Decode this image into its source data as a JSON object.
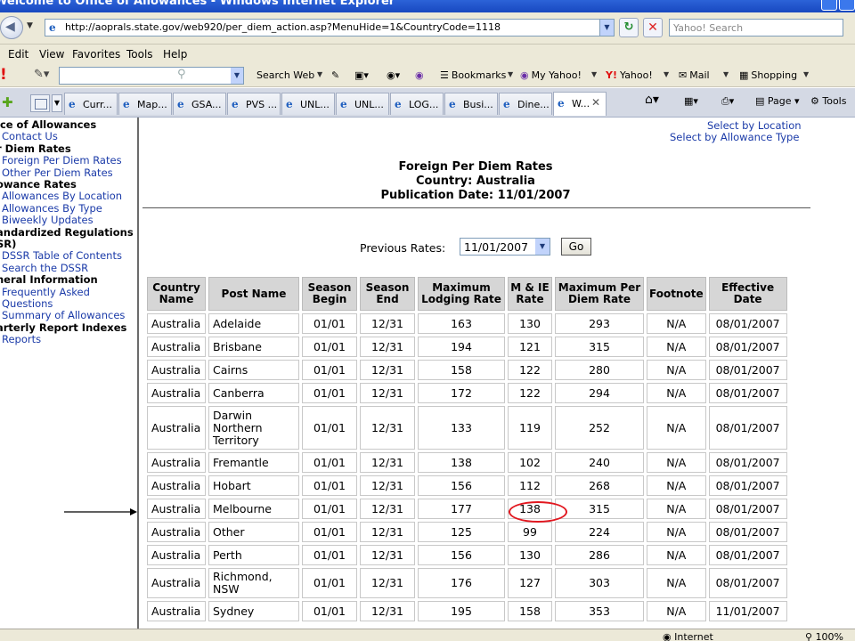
{
  "window": {
    "title": "Welcome to Office of Allowances - Windows Internet Explorer"
  },
  "address_bar": {
    "url": "http://aoprals.state.gov/web920/per_diem_action.asp?MenuHide=1&CountryCode=1118"
  },
  "search": {
    "placeholder": "Yahoo! Search"
  },
  "menu": [
    "Edit",
    "View",
    "Favorites",
    "Tools",
    "Help"
  ],
  "yahoo_toolbar": {
    "search_web": "Search Web",
    "bookmarks": "Bookmarks",
    "my_yahoo": "My Yahoo!",
    "yahoo": "Yahoo!",
    "mail": "Mail",
    "shopping": "Shopping"
  },
  "tabs": [
    "Curr...",
    "Map...",
    "GSA...",
    "PVS ...",
    "UNL...",
    "UNL...",
    "LOG...",
    "Busi...",
    "Dine...",
    "W..."
  ],
  "tab_toolbar": {
    "page": "Page",
    "tools": "Tools"
  },
  "sidebar": [
    {
      "text": "ice of Allowances",
      "type": "head"
    },
    {
      "text": "Contact Us",
      "type": "link"
    },
    {
      "text": "r Diem Rates",
      "type": "head"
    },
    {
      "text": "Foreign Per Diem Rates",
      "type": "link"
    },
    {
      "text": "Other Per Diem Rates",
      "type": "link"
    },
    {
      "text": "owance Rates",
      "type": "head"
    },
    {
      "text": "Allowances By Location",
      "type": "link"
    },
    {
      "text": "Allowances By Type",
      "type": "link"
    },
    {
      "text": "Biweekly Updates",
      "type": "link"
    },
    {
      "text": "andardized Regulations",
      "type": "head"
    },
    {
      "text": "SR)",
      "type": "head"
    },
    {
      "text": "DSSR Table of Contents",
      "type": "link"
    },
    {
      "text": "Search the DSSR",
      "type": "link"
    },
    {
      "text": "neral Information",
      "type": "head"
    },
    {
      "text": "Frequently Asked",
      "type": "link"
    },
    {
      "text": "Questions",
      "type": "link"
    },
    {
      "text": "Summary of Allowances",
      "type": "link"
    },
    {
      "text": "arterly Report Indexes",
      "type": "head"
    },
    {
      "text": "Reports",
      "type": "link"
    }
  ],
  "links": {
    "select_by_location": "Select by Location",
    "select_by_type": "Select by Allowance Type"
  },
  "heading": {
    "line1": "Foreign Per Diem Rates",
    "line2": "Country: Australia",
    "line3": "Publication Date: 11/01/2007"
  },
  "previous_rates": {
    "label": "Previous Rates:",
    "selected": "11/01/2007",
    "go": "Go"
  },
  "table": {
    "headers": [
      [
        "Country",
        "Name"
      ],
      [
        "Post Name"
      ],
      [
        "Season",
        "Begin"
      ],
      [
        "Season",
        "End"
      ],
      [
        "Maximum",
        "Lodging Rate"
      ],
      [
        "M & IE",
        "Rate"
      ],
      [
        "Maximum Per",
        "Diem Rate"
      ],
      [
        "Footnote"
      ],
      [
        "Effective",
        "Date"
      ]
    ],
    "rows": [
      {
        "post": [
          "Adelaide"
        ],
        "country": "Australia",
        "begin": "01/01",
        "end": "12/31",
        "lodging": "163",
        "mie": "130",
        "max": "293",
        "footnote": "N/A",
        "effective": "08/01/2007"
      },
      {
        "post": [
          "Brisbane"
        ],
        "country": "Australia",
        "begin": "01/01",
        "end": "12/31",
        "lodging": "194",
        "mie": "121",
        "max": "315",
        "footnote": "N/A",
        "effective": "08/01/2007"
      },
      {
        "post": [
          "Cairns"
        ],
        "country": "Australia",
        "begin": "01/01",
        "end": "12/31",
        "lodging": "158",
        "mie": "122",
        "max": "280",
        "footnote": "N/A",
        "effective": "08/01/2007"
      },
      {
        "post": [
          "Canberra"
        ],
        "country": "Australia",
        "begin": "01/01",
        "end": "12/31",
        "lodging": "172",
        "mie": "122",
        "max": "294",
        "footnote": "N/A",
        "effective": "08/01/2007"
      },
      {
        "post": [
          "Darwin",
          "Northern",
          "Territory"
        ],
        "country": "Australia",
        "begin": "01/01",
        "end": "12/31",
        "lodging": "133",
        "mie": "119",
        "max": "252",
        "footnote": "N/A",
        "effective": "08/01/2007"
      },
      {
        "post": [
          "Fremantle"
        ],
        "country": "Australia",
        "begin": "01/01",
        "end": "12/31",
        "lodging": "138",
        "mie": "102",
        "max": "240",
        "footnote": "N/A",
        "effective": "08/01/2007"
      },
      {
        "post": [
          "Hobart"
        ],
        "country": "Australia",
        "begin": "01/01",
        "end": "12/31",
        "lodging": "156",
        "mie": "112",
        "max": "268",
        "footnote": "N/A",
        "effective": "08/01/2007"
      },
      {
        "post": [
          "Melbourne"
        ],
        "country": "Australia",
        "begin": "01/01",
        "end": "12/31",
        "lodging": "177",
        "mie": "138",
        "max": "315",
        "footnote": "N/A",
        "effective": "08/01/2007",
        "highlight": true
      },
      {
        "post": [
          "Other"
        ],
        "country": "Australia",
        "begin": "01/01",
        "end": "12/31",
        "lodging": "125",
        "mie": "99",
        "max": "224",
        "footnote": "N/A",
        "effective": "08/01/2007"
      },
      {
        "post": [
          "Perth"
        ],
        "country": "Australia",
        "begin": "01/01",
        "end": "12/31",
        "lodging": "156",
        "mie": "130",
        "max": "286",
        "footnote": "N/A",
        "effective": "08/01/2007"
      },
      {
        "post": [
          "Richmond,",
          "NSW"
        ],
        "country": "Australia",
        "begin": "01/01",
        "end": "12/31",
        "lodging": "176",
        "mie": "127",
        "max": "303",
        "footnote": "N/A",
        "effective": "08/01/2007"
      },
      {
        "post": [
          "Sydney"
        ],
        "country": "Australia",
        "begin": "01/01",
        "end": "12/31",
        "lodging": "195",
        "mie": "158",
        "max": "353",
        "footnote": "N/A",
        "effective": "11/01/2007"
      }
    ]
  },
  "status": {
    "zone": "Internet",
    "zoom": "100%"
  },
  "colors": {
    "title_bar": "#1848c0",
    "link": "#1a3aa8",
    "highlight": "#e2171f",
    "header_bg": "#d6d6d6"
  }
}
